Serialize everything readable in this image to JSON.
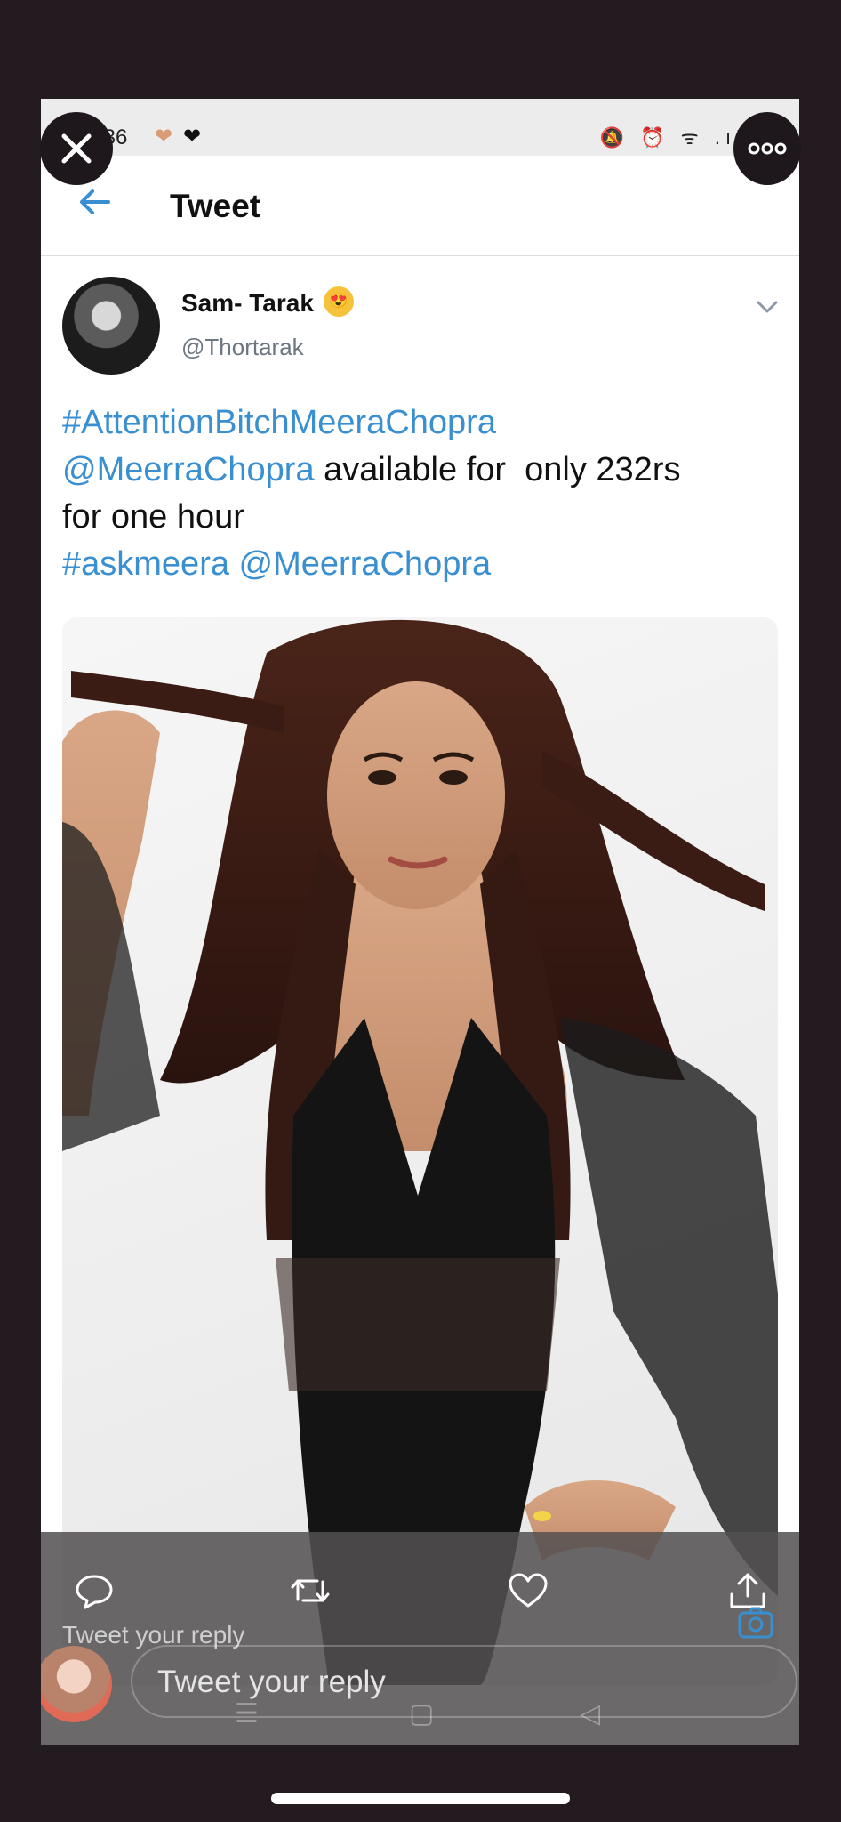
{
  "status_bar": {
    "time": ":36",
    "icons": "🔕 ⏰ ᯤ .ıl"
  },
  "header": {
    "title": "Tweet"
  },
  "tweet": {
    "display_name": "Sam- Tarak",
    "name_emoji": "😍",
    "handle": "@Thortarak",
    "text_lines": [
      [
        {
          "text": "#AttentionBitchMeeraChopra",
          "link": true
        }
      ],
      [
        {
          "text": "@MeerraChopra",
          "link": true
        },
        {
          "text": " available for  only 232rs",
          "link": false
        }
      ],
      [
        {
          "text": "for one hour",
          "link": false
        }
      ],
      [
        {
          "text": "#askmeera",
          "link": true
        },
        {
          "text": " ",
          "link": false
        },
        {
          "text": "@MeerraChopra",
          "link": true
        }
      ]
    ]
  },
  "reply_bar": {
    "hint": "Tweet your reply",
    "placeholder": "Tweet your reply",
    "ghost_nav": [
      "☰",
      "▢",
      "◁"
    ]
  },
  "colors": {
    "link": "#3a8fd1",
    "page_bg": "#231b20",
    "overlay": "#545052"
  }
}
